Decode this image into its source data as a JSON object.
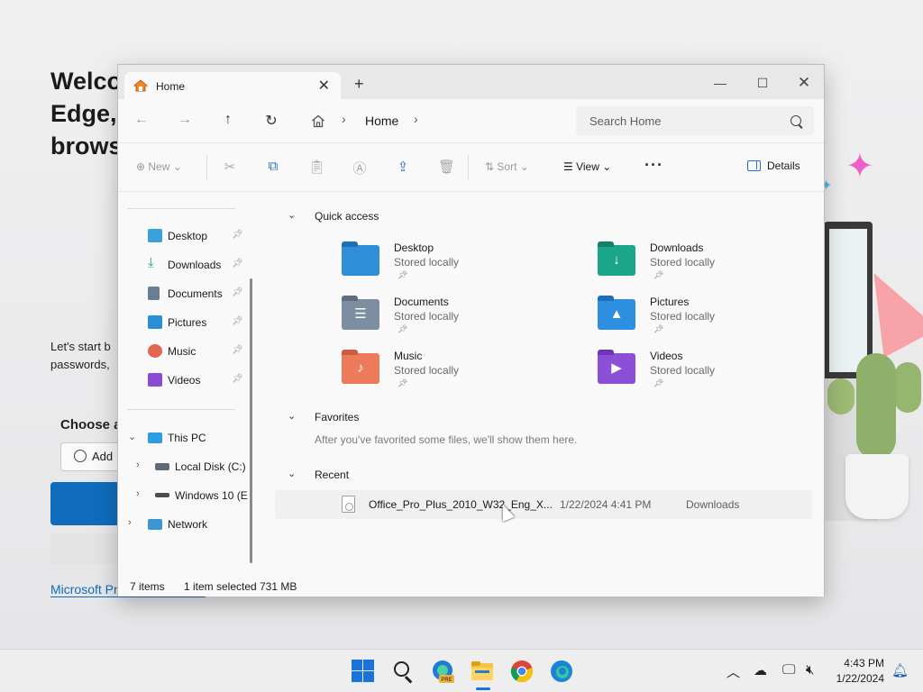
{
  "background": {
    "title_lines": [
      "Welco",
      "Edge,",
      "brows"
    ],
    "subtitle_lines": [
      "Let's start b",
      "passwords,"
    ],
    "choose_text": "Choose a",
    "add_button": "Add",
    "link_text": "Microsoft Pr"
  },
  "window": {
    "tab_title": "Home",
    "address": {
      "location": "Home"
    },
    "search_placeholder": "Search Home",
    "commands": {
      "new": "New",
      "sort": "Sort",
      "view": "View",
      "details": "Details"
    }
  },
  "sidebar": {
    "pinned": [
      {
        "label": "Desktop",
        "icon": "desktop-folder-icon",
        "color": "#3aa0d8"
      },
      {
        "label": "Downloads",
        "icon": "download-arrow-icon",
        "color": "#1f9e8a"
      },
      {
        "label": "Documents",
        "icon": "documents-icon",
        "color": "#6b7d92"
      },
      {
        "label": "Pictures",
        "icon": "pictures-icon",
        "color": "#2a8fd6"
      },
      {
        "label": "Music",
        "icon": "music-icon",
        "color": "#e0664d"
      },
      {
        "label": "Videos",
        "icon": "videos-icon",
        "color": "#8a4ad6"
      }
    ],
    "tree": [
      {
        "label": "This PC",
        "icon": "monitor-icon",
        "expanded": true
      },
      {
        "label": "Local Disk (C:)",
        "icon": "drive-icon"
      },
      {
        "label": "Windows 10 (E",
        "icon": "drive-icon"
      },
      {
        "label": "Network",
        "icon": "network-icon"
      }
    ]
  },
  "main": {
    "quick_access": {
      "heading": "Quick access",
      "items": [
        {
          "name": "Desktop",
          "status": "Stored locally",
          "color": "#2e8fd8",
          "glyph": ""
        },
        {
          "name": "Downloads",
          "status": "Stored locally",
          "color": "#1ba58a",
          "glyph": "↓"
        },
        {
          "name": "Documents",
          "status": "Stored locally",
          "color": "#7d8ea3",
          "glyph": "☰"
        },
        {
          "name": "Pictures",
          "status": "Stored locally",
          "color": "#2c8fe0",
          "glyph": "▲"
        },
        {
          "name": "Music",
          "status": "Stored locally",
          "color": "#ee7a5c",
          "glyph": "♪"
        },
        {
          "name": "Videos",
          "status": "Stored locally",
          "color": "#8b4fd8",
          "glyph": "▶"
        }
      ]
    },
    "favorites": {
      "heading": "Favorites",
      "empty_message": "After you've favorited some files, we'll show them here."
    },
    "recent": {
      "heading": "Recent",
      "items": [
        {
          "name": "Office_Pro_Plus_2010_W32_Eng_X...",
          "date": "1/22/2024 4:41 PM",
          "location": "Downloads"
        }
      ]
    }
  },
  "status": {
    "items": "7 items",
    "selected": "1 item selected",
    "size": "731 MB"
  },
  "taskbar": {
    "time": "4:43 PM",
    "date": "1/22/2024",
    "edge_badge": "PRE"
  }
}
